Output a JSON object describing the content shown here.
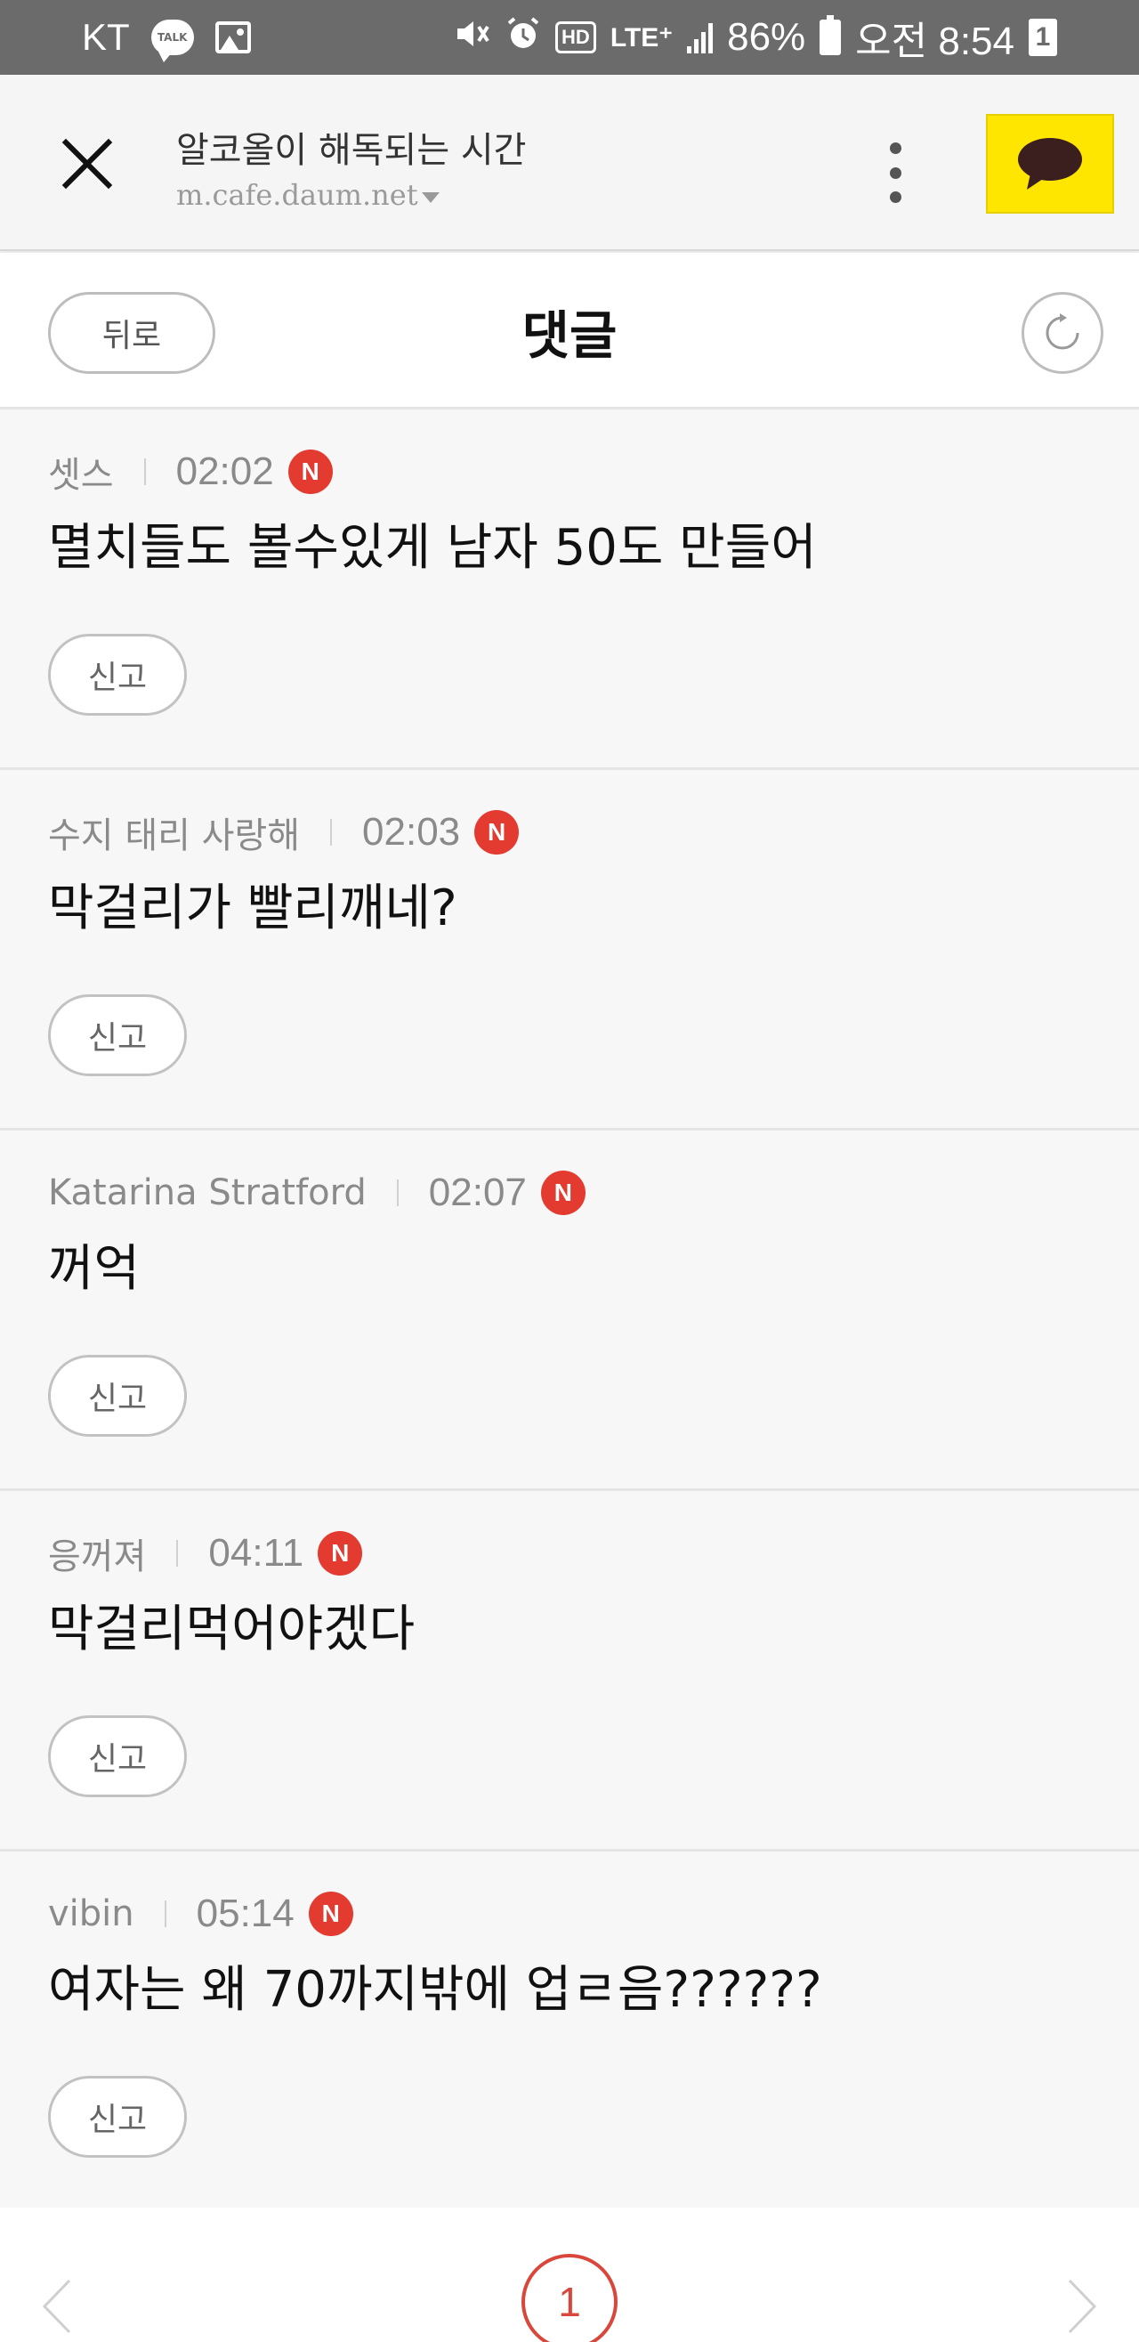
{
  "status_bar": {
    "carrier": "KT",
    "talk_icon_text": "TALK",
    "hd": "HD",
    "network": "LTE⁺",
    "battery_percent": "86%",
    "time": "오전 8:54",
    "notification_count": "1"
  },
  "browser": {
    "title": "알코올이 해독되는 시간",
    "url": "m.cafe.daum.net",
    "kakao_color": "#ffe600"
  },
  "header": {
    "back_label": "뒤로",
    "title": "댓글"
  },
  "comments": [
    {
      "author": "셋스",
      "time": "02:02",
      "badge": "N",
      "text": "멸치들도 볼수있게 남자 50도 만들어",
      "report_label": "신고"
    },
    {
      "author": "수지 태리 사랑해",
      "time": "02:03",
      "badge": "N",
      "text": "막걸리가 빨리깨네?",
      "report_label": "신고"
    },
    {
      "author": "Katarina Stratford",
      "time": "02:07",
      "badge": "N",
      "text": "꺼억",
      "report_label": "신고"
    },
    {
      "author": "응꺼져",
      "time": "04:11",
      "badge": "N",
      "text": "막걸리먹어야겠다",
      "report_label": "신고"
    },
    {
      "author": "vibin",
      "time": "05:14",
      "badge": "N",
      "text": "여자는 왜 70까지밖에 업ㄹ음??????",
      "report_label": "신고"
    }
  ],
  "pagination": {
    "current_page": "1"
  },
  "colors": {
    "new_badge": "#e33b30",
    "page_accent": "#d9463b"
  }
}
